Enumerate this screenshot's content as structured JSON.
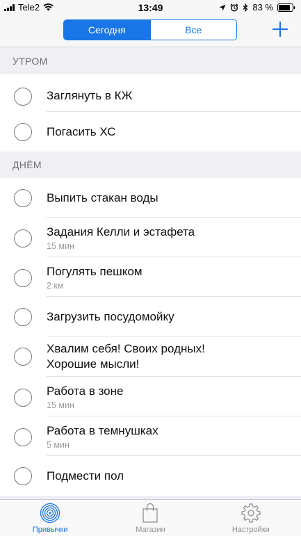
{
  "status_bar": {
    "carrier": "Tele2",
    "time": "13:49",
    "battery": "83 %"
  },
  "nav": {
    "segments": [
      "Сегодня",
      "Все"
    ],
    "selected_segment": "Сегодня",
    "add_icon": "plus-icon"
  },
  "sections": [
    {
      "header": "УТРОМ",
      "items": [
        {
          "title": "Заглянуть в КЖ",
          "subtitle": ""
        },
        {
          "title": "Погасить ХС",
          "subtitle": ""
        }
      ]
    },
    {
      "header": "ДНЁМ",
      "items": [
        {
          "title": "Выпить стакан воды",
          "subtitle": ""
        },
        {
          "title": "Задания Келли и эстафета",
          "subtitle": "15 мин"
        },
        {
          "title": "Погулять пешком",
          "subtitle": "2 км"
        },
        {
          "title": "Загрузить посудомойку",
          "subtitle": ""
        },
        {
          "title": "Хвалим себя! Своих родных! Хорошие мысли!",
          "subtitle": ""
        },
        {
          "title": "Работа в зоне",
          "subtitle": "15 мин"
        },
        {
          "title": "Работа в темнушках",
          "subtitle": "5 мин"
        },
        {
          "title": "Подмести пол",
          "subtitle": ""
        }
      ]
    }
  ],
  "tab_bar": {
    "tabs": [
      {
        "label": "Привычки",
        "icon": "target-icon",
        "active": true
      },
      {
        "label": "Магазин",
        "icon": "shopping-bag-icon",
        "active": false
      },
      {
        "label": "Настройки",
        "icon": "gear-icon",
        "active": false
      }
    ]
  },
  "colors": {
    "accent": "#1976e6",
    "section_background": "#efeff4",
    "inactive_tab": "#8e8e93"
  }
}
